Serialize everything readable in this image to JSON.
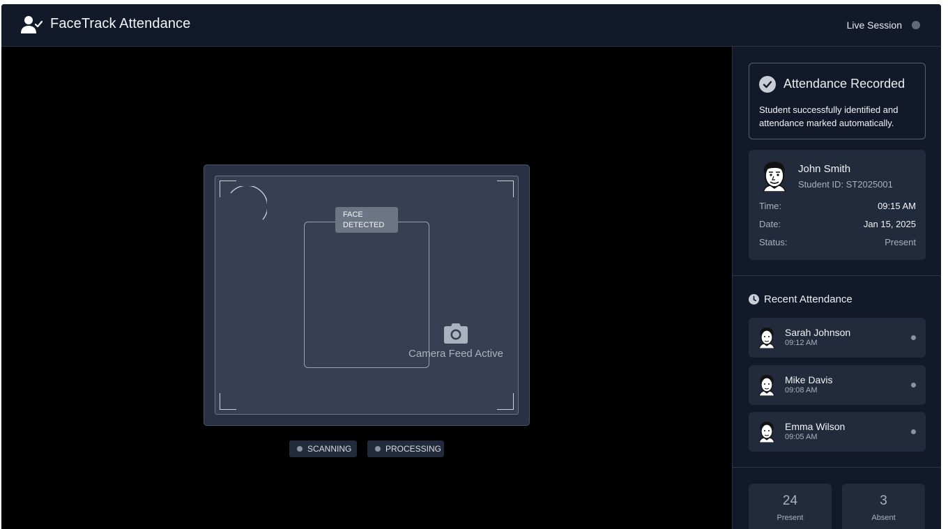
{
  "header": {
    "title": "FaceTrack Attendance",
    "brand_icon": "user-check-icon",
    "live_label": "Live Session"
  },
  "camera": {
    "face_tag": "FACE\nDETECTED",
    "feed_text": "Camera Feed Active",
    "camera_icon": "camera-icon",
    "status_pills": [
      {
        "label": "SCANNING"
      },
      {
        "label": "PROCESSING"
      }
    ]
  },
  "recorded": {
    "title": "Attendance Recorded",
    "description": "Student successfully identified and attendance marked automatically.",
    "icon": "check-circle-icon"
  },
  "student": {
    "name": "John Smith",
    "id_text": "Student ID: ST2025001",
    "rows": [
      {
        "label": "Time:",
        "value": "09:15 AM"
      },
      {
        "label": "Date:",
        "value": "Jan 15, 2025"
      },
      {
        "label": "Status:",
        "value": "Present"
      }
    ]
  },
  "recent": {
    "title": "Recent Attendance",
    "icon": "clock-icon",
    "items": [
      {
        "name": "Sarah Johnson",
        "time": "09:12 AM"
      },
      {
        "name": "Mike Davis",
        "time": "09:08 AM"
      },
      {
        "name": "Emma Wilson",
        "time": "09:05 AM"
      }
    ]
  },
  "stats": {
    "present": {
      "value": "24",
      "label": "Present"
    },
    "absent": {
      "value": "3",
      "label": "Absent"
    }
  },
  "colors": {
    "background": "#000000",
    "panel": "#121a29",
    "card": "#222b3b",
    "frame": "#364052",
    "status_dot": "#626b78"
  }
}
